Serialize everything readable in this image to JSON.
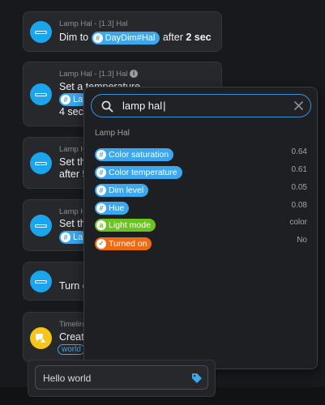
{
  "cards": [
    {
      "subtitle": "Lamp Hal - [1.3] Hal",
      "text_pre": "Dim to",
      "tag": "DayDim#Hal",
      "text_post": "after",
      "bold": "2 sec"
    },
    {
      "subtitle": "Lamp Hal - [1.3] Hal",
      "line1": "Set a temperature",
      "tag": "La",
      "line3": "4 sec"
    },
    {
      "subtitle": "Lamp H",
      "line1": "Set th",
      "line2": "after 5"
    },
    {
      "subtitle": "Lamp H",
      "line1": "Set th",
      "tag": "La"
    },
    {
      "line1": "Turn o"
    },
    {
      "subtitle": "Timeline",
      "line1": "Create",
      "tag": "world"
    }
  ],
  "search": {
    "query": "lamp hal"
  },
  "dropdown": {
    "group_label": "Lamp Hal",
    "items": [
      {
        "label": "Color saturation",
        "value": "0.64",
        "kind": "number"
      },
      {
        "label": "Color temperature",
        "value": "0.61",
        "kind": "number"
      },
      {
        "label": "Dim level",
        "value": "0.05",
        "kind": "number"
      },
      {
        "label": "Hue",
        "value": "0.08",
        "kind": "number"
      },
      {
        "label": "Light mode",
        "value": "color",
        "kind": "text"
      },
      {
        "label": "Turned on",
        "value": "No",
        "kind": "boolean"
      }
    ]
  },
  "composer": {
    "text": "Hello world"
  },
  "colors": {
    "accent": "#3aa7ef",
    "lamp_icon": "#1aa5ec",
    "green": "#6cc21f",
    "orange": "#f06a12",
    "timeline_icon": "#f5c518"
  }
}
